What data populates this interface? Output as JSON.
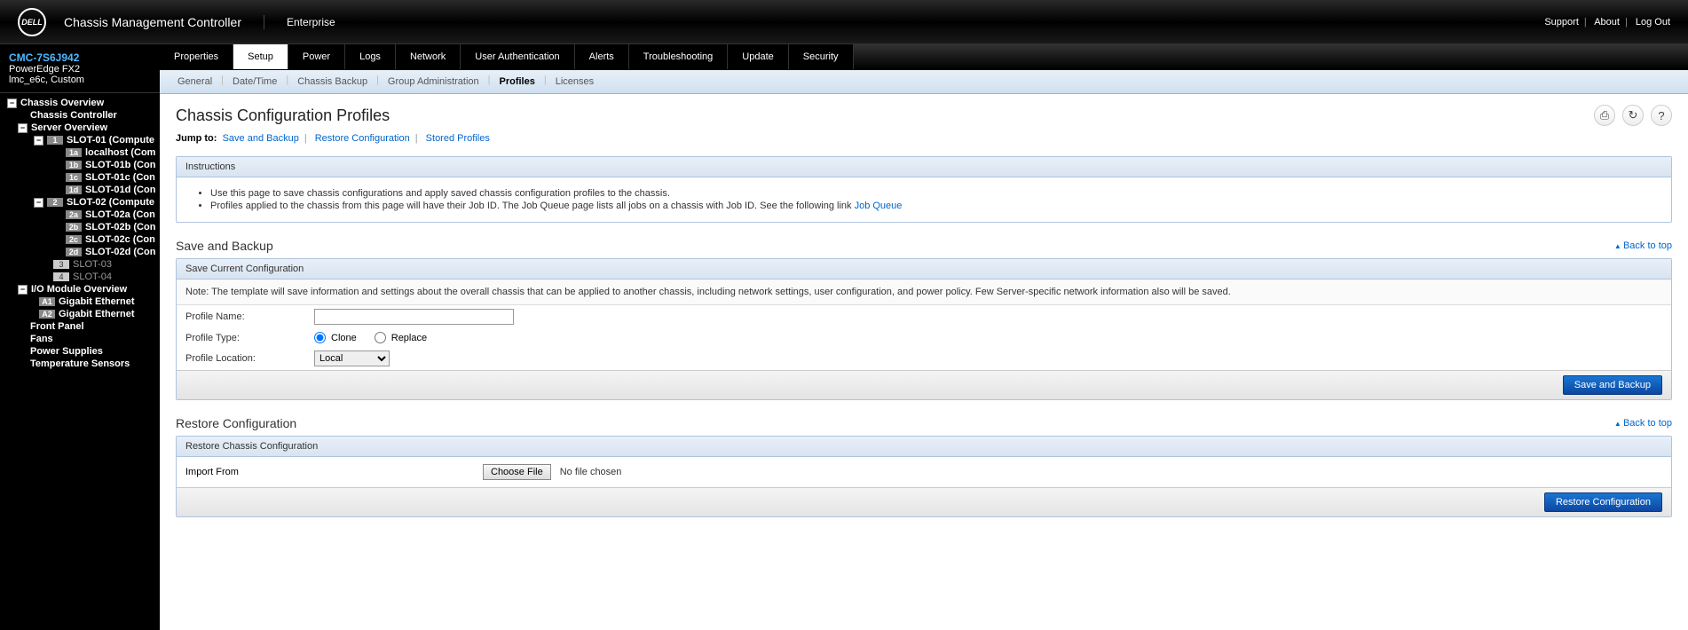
{
  "header": {
    "brand": "DELL",
    "title": "Chassis Management Controller",
    "subtitle": "Enterprise",
    "links": {
      "support": "Support",
      "about": "About",
      "logout": "Log Out"
    }
  },
  "device": {
    "name": "CMC-7S6J942",
    "model": "PowerEdge FX2",
    "detail": "lmc_e6c, Custom"
  },
  "tree": {
    "root": "Chassis Overview",
    "controller": "Chassis Controller",
    "server": "Server Overview",
    "slot1": "SLOT-01 (Compute",
    "slot1a": "localhost (Com",
    "slot1b": "SLOT-01b (Con",
    "slot1c": "SLOT-01c (Con",
    "slot1d": "SLOT-01d (Con",
    "slot2": "SLOT-02 (Compute",
    "slot2a": "SLOT-02a (Con",
    "slot2b": "SLOT-02b (Con",
    "slot2c": "SLOT-02c (Con",
    "slot2d": "SLOT-02d (Con",
    "slot3": "SLOT-03",
    "slot4": "SLOT-04",
    "io": "I/O Module Overview",
    "ioA1": "Gigabit Ethernet",
    "ioA2": "Gigabit Ethernet",
    "front": "Front Panel",
    "fans": "Fans",
    "power": "Power Supplies",
    "temp": "Temperature Sensors"
  },
  "tabs": [
    "Properties",
    "Setup",
    "Power",
    "Logs",
    "Network",
    "User Authentication",
    "Alerts",
    "Troubleshooting",
    "Update",
    "Security"
  ],
  "activeTab": "Setup",
  "subtabs": [
    "General",
    "Date/Time",
    "Chassis Backup",
    "Group Administration",
    "Profiles",
    "Licenses"
  ],
  "activeSubtab": "Profiles",
  "page": {
    "title": "Chassis Configuration Profiles",
    "jumpLabel": "Jump to:",
    "jump": [
      "Save and Backup",
      "Restore Configuration",
      "Stored Profiles"
    ]
  },
  "instructions": {
    "header": "Instructions",
    "line1": "Use this page to save chassis configurations and apply saved chassis configuration profiles to the chassis.",
    "line2": "Profiles applied to the chassis from this page will have their Job ID. The Job Queue page lists all jobs on a chassis with Job ID. See the following link ",
    "link": "Job Queue"
  },
  "save": {
    "sectionTitle": "Save and Backup",
    "backtop": "Back to top",
    "panelHeader": "Save Current Configuration",
    "note": "Note: The template will save information and settings about the overall chassis that can be applied to another chassis, including network settings, user configuration, and power policy. Few Server-specific network information also will be saved.",
    "profileNameLabel": "Profile Name:",
    "profileNameValue": "",
    "profileTypeLabel": "Profile Type:",
    "clone": "Clone",
    "replace": "Replace",
    "locationLabel": "Profile Location:",
    "locationValue": "Local",
    "button": "Save and Backup"
  },
  "restore": {
    "sectionTitle": "Restore Configuration",
    "backtop": "Back to top",
    "panelHeader": "Restore Chassis Configuration",
    "importLabel": "Import From",
    "chooseFile": "Choose File",
    "noFile": "No file chosen",
    "button": "Restore Configuration"
  }
}
